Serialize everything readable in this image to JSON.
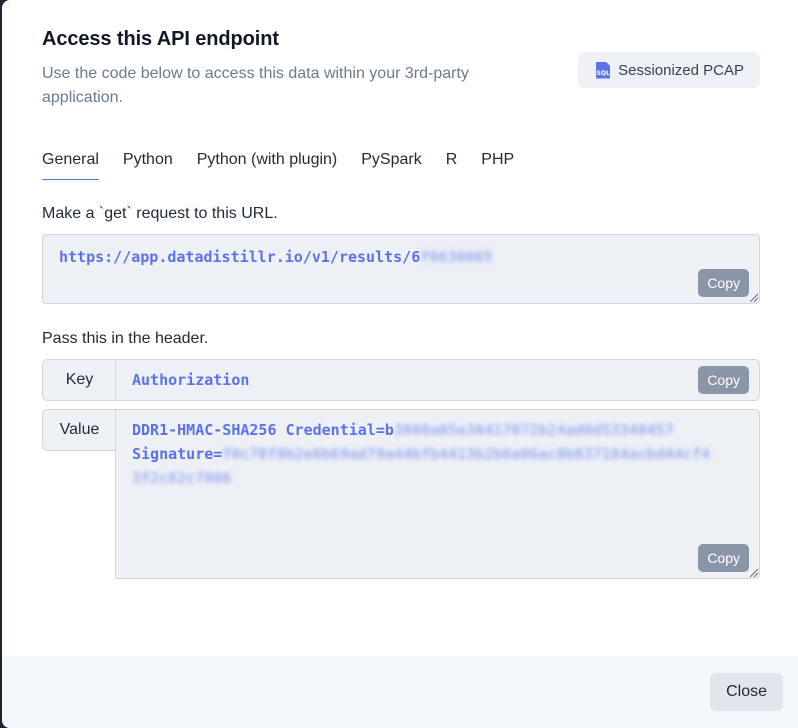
{
  "modal": {
    "title": "Access this API endpoint",
    "subtitle": "Use the code below to access this data within your 3rd-party application.",
    "dataset_button": {
      "icon": "sql-file-icon",
      "icon_text": "SQL",
      "label": "Sessionized PCAP"
    },
    "tabs": [
      {
        "label": "General",
        "active": true
      },
      {
        "label": "Python",
        "active": false
      },
      {
        "label": "Python (with plugin)",
        "active": false
      },
      {
        "label": "PySpark",
        "active": false
      },
      {
        "label": "R",
        "active": false
      },
      {
        "label": "PHP",
        "active": false
      }
    ],
    "url_section": {
      "label": "Make a `get` request to this URL.",
      "url_visible": "https://app.datadistillr.io/v1/results/6",
      "url_redacted": "f6630065",
      "copy_label": "Copy"
    },
    "header_section": {
      "label": "Pass this in the header.",
      "key_label": "Key",
      "key_value": "Authorization",
      "value_label": "Value",
      "value_line1_visible": "DDR1-HMAC-SHA256 Credential=b",
      "value_line1_redacted": "3808a05e30417072b24ad0d53348457",
      "value_line2_visible": "Signature=",
      "value_line2_redacted": "f0c70f0b2e6b69ad79a44bfb4413b2b6a06ac0b837184acbd44cf4",
      "value_line3_redacted": "3f2c82c7066",
      "copy_label": "Copy"
    },
    "footer": {
      "close_label": "Close"
    }
  },
  "colors": {
    "accent": "#5b72e8",
    "code_bg": "#edf1f6",
    "copy_button_bg": "#8a96a8",
    "footer_bg": "#f4f7fa",
    "close_button_bg": "#e1e6ee",
    "subtitle_text": "#6b7a90"
  }
}
